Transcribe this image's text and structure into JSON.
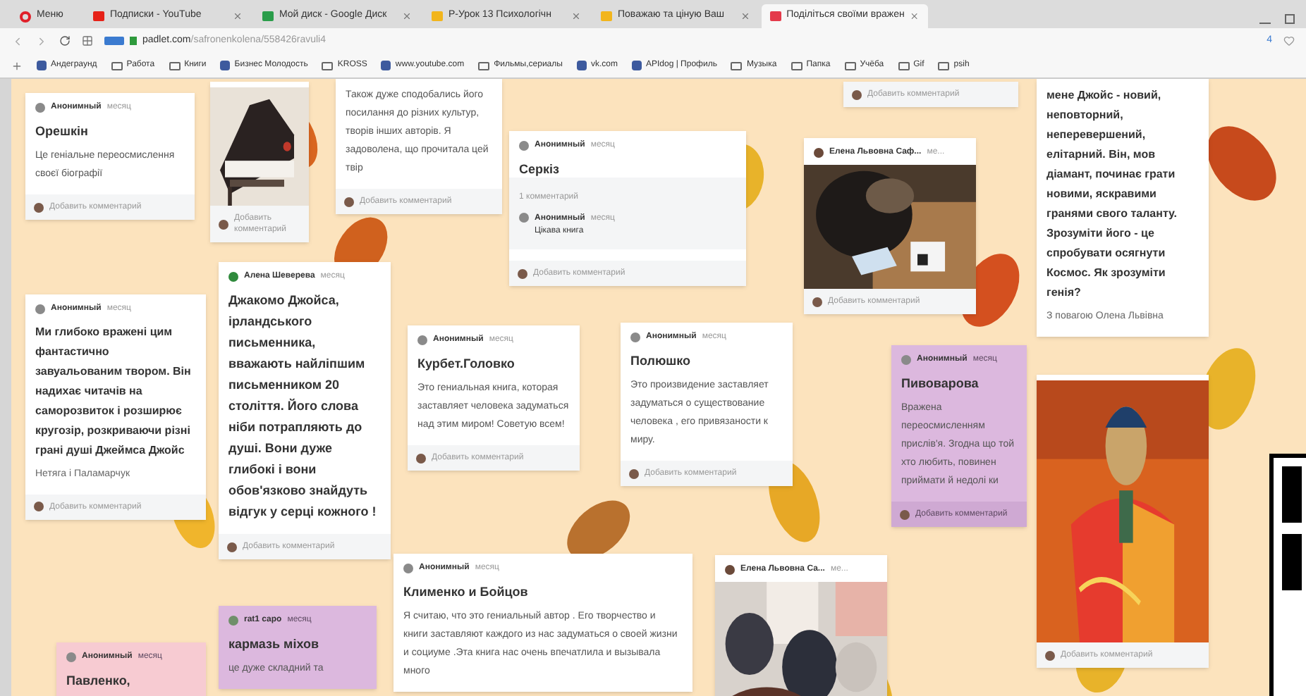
{
  "browser": {
    "tabs": [
      {
        "label": "Меню",
        "kind": "menu",
        "selected": false
      },
      {
        "label": "Подписки - YouTube",
        "kind": "page",
        "selected": false
      },
      {
        "label": "Мой диск - Google Диск",
        "kind": "page",
        "selected": false
      },
      {
        "label": "Р-Урок 13 Психологічн",
        "kind": "page",
        "selected": false
      },
      {
        "label": "Поважаю та ціную Ваш",
        "kind": "page",
        "selected": false
      },
      {
        "label": "Поділіться своїми вражен",
        "kind": "page",
        "selected": true
      }
    ],
    "url_host": "padlet.com",
    "url_path": "/safronenkolena/558426ravuli4",
    "badge": "4",
    "bookmarks": [
      {
        "label": "Андеграунд",
        "kind": "site"
      },
      {
        "label": "Работа",
        "kind": "folder"
      },
      {
        "label": "Книги",
        "kind": "folder"
      },
      {
        "label": "Бизнес Молодость",
        "kind": "site"
      },
      {
        "label": "KROSS",
        "kind": "folder"
      },
      {
        "label": "www.youtube.com",
        "kind": "site"
      },
      {
        "label": "Фильмы,сериалы",
        "kind": "folder"
      },
      {
        "label": "vk.com",
        "kind": "site"
      },
      {
        "label": "APIdog | Профиль",
        "kind": "site"
      },
      {
        "label": "Музыка",
        "kind": "folder"
      },
      {
        "label": "Папка",
        "kind": "folder"
      },
      {
        "label": "Учёба",
        "kind": "folder"
      },
      {
        "label": "Gif",
        "kind": "folder"
      },
      {
        "label": "psih",
        "kind": "folder"
      }
    ]
  },
  "board": {
    "cards": [
      {
        "color": "#ffffff",
        "bold": false,
        "author": "Анонимный",
        "avatar": {
          "color": "#8a8a8a"
        },
        "time": "месяц",
        "title": "Орешкін",
        "body": "Це геніальне переосмислення своєї біографії",
        "footer": "Добавить комментарий"
      },
      {
        "color": "#ffffff",
        "footer": "Добавить комментарий"
      },
      {
        "color": "#ffffff",
        "bold": false,
        "body": "Також дуже сподобались його посилання до різних культур, творів інших авторів. Я задоволена, що прочитала цей твір",
        "footer": "Добавить комментарий"
      },
      {
        "color": "#ffffff",
        "author": "Анонимный",
        "avatar": {
          "color": "#8a8a8a"
        },
        "time": "месяц",
        "title": "Серкіз",
        "comments_count": "1 комментарий",
        "comments": [
          {
            "author": "Анонимный",
            "time": "месяц",
            "text": "Цікава книга"
          }
        ],
        "footer": "Добавить комментарий"
      },
      {
        "color": "#ffffff",
        "footer": "Добавить комментарий"
      },
      {
        "color": "#ffffff",
        "author": "Елена Львовна Саф...",
        "avatar": {
          "color": "#6b4a3a"
        },
        "time": "ме...",
        "footer": "Добавить комментарий"
      },
      {
        "color": "#ffffff",
        "bold": true,
        "body": "мене Джойс  - новий, неповторний, неперевершений, елітарний.  Він, мов діамант, починає грати новими, яскравими гранями свого таланту. Зрозуміти його  - це спробувати осягнути Космос. Як зрозуміти генія?",
        "signature": "З повагою Олена Львівна"
      },
      {
        "color": "#ffffff",
        "footer": "Добавить комментарий"
      },
      {
        "color": "#ffffff",
        "bold": true,
        "author": "Анонимный",
        "avatar": {
          "color": "#8a8a8a"
        },
        "time": "месяц",
        "body": "Ми глибоко вражені цим фантастично завуальованим твором. Він надихає читачів на саморозвиток і розширює кругозір, розкриваючи різні грані душі Джеймса Джойс",
        "signature": "Нетяга і Паламарчук",
        "footer": "Добавить комментарий"
      },
      {
        "color": "#ffffff",
        "bold": true,
        "author": "Алена Шеверева",
        "avatar": {
          "color": "#2f8a3c"
        },
        "time": "месяц",
        "body": "Джакомо Джойса, ірландського письменника, вважають найліпшим письменником 20 століття. Його слова ніби потрапляють до душі. Вони дуже глибокі і вони обов'язково знайдуть відгук у серці кожного !",
        "footer": "Добавить комментарий"
      },
      {
        "color": "#ffffff",
        "bold": false,
        "author": "Анонимный",
        "avatar": {
          "color": "#8a8a8a"
        },
        "time": "месяц",
        "title": "Курбет.Головко",
        "body": "Это гениальная книга, которая заставляет человека задуматься над этим миром! Советую всем!",
        "footer": "Добавить комментарий"
      },
      {
        "color": "#ffffff",
        "bold": false,
        "author": "Анонимный",
        "avatar": {
          "color": "#8a8a8a"
        },
        "time": "месяц",
        "title": "Полюшко",
        "body": "Это произвидение заставляет задуматься о существование человека , его привязаности к миру.",
        "footer": "Добавить комментарий"
      },
      {
        "color": "#dcb8de",
        "bold": false,
        "author": "Анонимный",
        "avatar": {
          "color": "#8a8a8a"
        },
        "time": "месяц",
        "title": "Пивоварова",
        "body": "Вражена переосмисленням прислів'я. Згодна що той хто любить, повинен приймати й недолі ки",
        "footer": "Добавить комментарий"
      },
      {
        "color": "#f7cbd2",
        "author": "Анонимный",
        "avatar": {
          "color": "#8a8a8a"
        },
        "time": "месяц",
        "title": "Павленко,"
      },
      {
        "color": "#dcb8de",
        "bold": false,
        "author": "rat1 capo",
        "avatar": {
          "color": "#6f8f6a"
        },
        "time": "месяц",
        "title": "кармазь міхов",
        "body": "це дуже складний та"
      },
      {
        "color": "#ffffff",
        "bold": false,
        "author": "Анонимный",
        "avatar": {
          "color": "#8a8a8a"
        },
        "time": "месяц",
        "title": "Клименко и Бойцов",
        "body": "Я считаю, что это гениальный автор . Его творчество и книги заставляют каждого из нас задуматься о своей жизни и социуме .Эта книга нас очень впечатлила и вызывала много"
      },
      {
        "color": "#ffffff",
        "author": "Елена Львовна Са...",
        "avatar": {
          "color": "#6b4a3a"
        },
        "time": "ме..."
      }
    ]
  }
}
